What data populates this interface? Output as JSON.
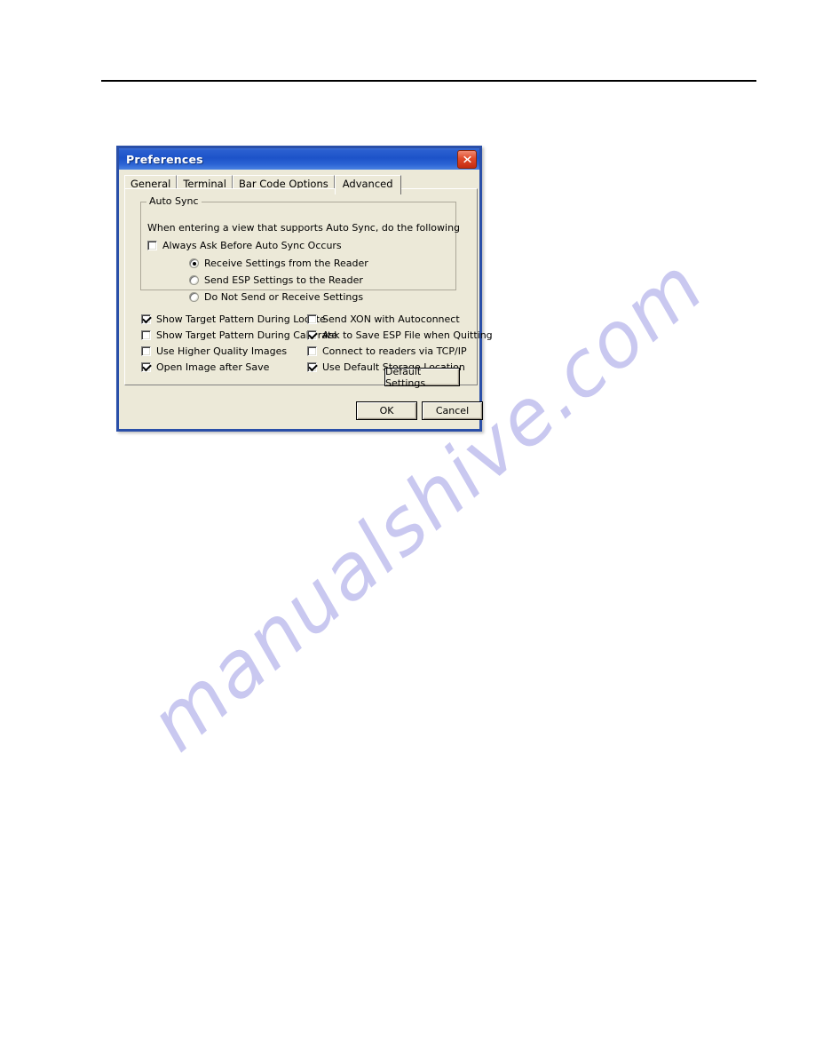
{
  "document": {
    "watermark": "manualshive.com"
  },
  "dialog": {
    "title": "Preferences",
    "close_icon": "close-icon",
    "tabs": [
      {
        "label": "General",
        "active": false
      },
      {
        "label": "Terminal",
        "active": false
      },
      {
        "label": "Bar Code Options",
        "active": false
      },
      {
        "label": "Advanced",
        "active": true
      }
    ],
    "auto_sync": {
      "legend": "Auto Sync",
      "description": "When entering a view that supports Auto Sync, do the following",
      "always_ask": {
        "label": "Always Ask Before Auto Sync Occurs",
        "checked": false
      },
      "radios": [
        {
          "label": "Receive Settings from the Reader",
          "selected": true
        },
        {
          "label": "Send ESP Settings to the Reader",
          "selected": false
        },
        {
          "label": "Do Not Send or Receive Settings",
          "selected": false
        }
      ]
    },
    "options_left": [
      {
        "label": "Show Target Pattern During Locate",
        "checked": true
      },
      {
        "label": "Show Target Pattern During Calibrate",
        "checked": false
      },
      {
        "label": "Use Higher Quality Images",
        "checked": false
      },
      {
        "label": "Open Image after Save",
        "checked": true
      }
    ],
    "options_right": [
      {
        "label": "Send XON with Autoconnect",
        "checked": false
      },
      {
        "label": "Ask to Save ESP File when Quitting",
        "checked": true
      },
      {
        "label": "Connect to readers via TCP/IP",
        "checked": false
      },
      {
        "label": "Use Default Storage Location",
        "checked": true
      }
    ],
    "buttons": {
      "default_settings": "Default Settings",
      "ok": "OK",
      "cancel": "Cancel"
    },
    "colors": {
      "titlebar_blue": "#1d53c9",
      "frame_blue": "#2a4fa8",
      "dialog_face": "#ece9d8",
      "close_red": "#c42c10",
      "watermark": "#c9c8f0"
    }
  }
}
